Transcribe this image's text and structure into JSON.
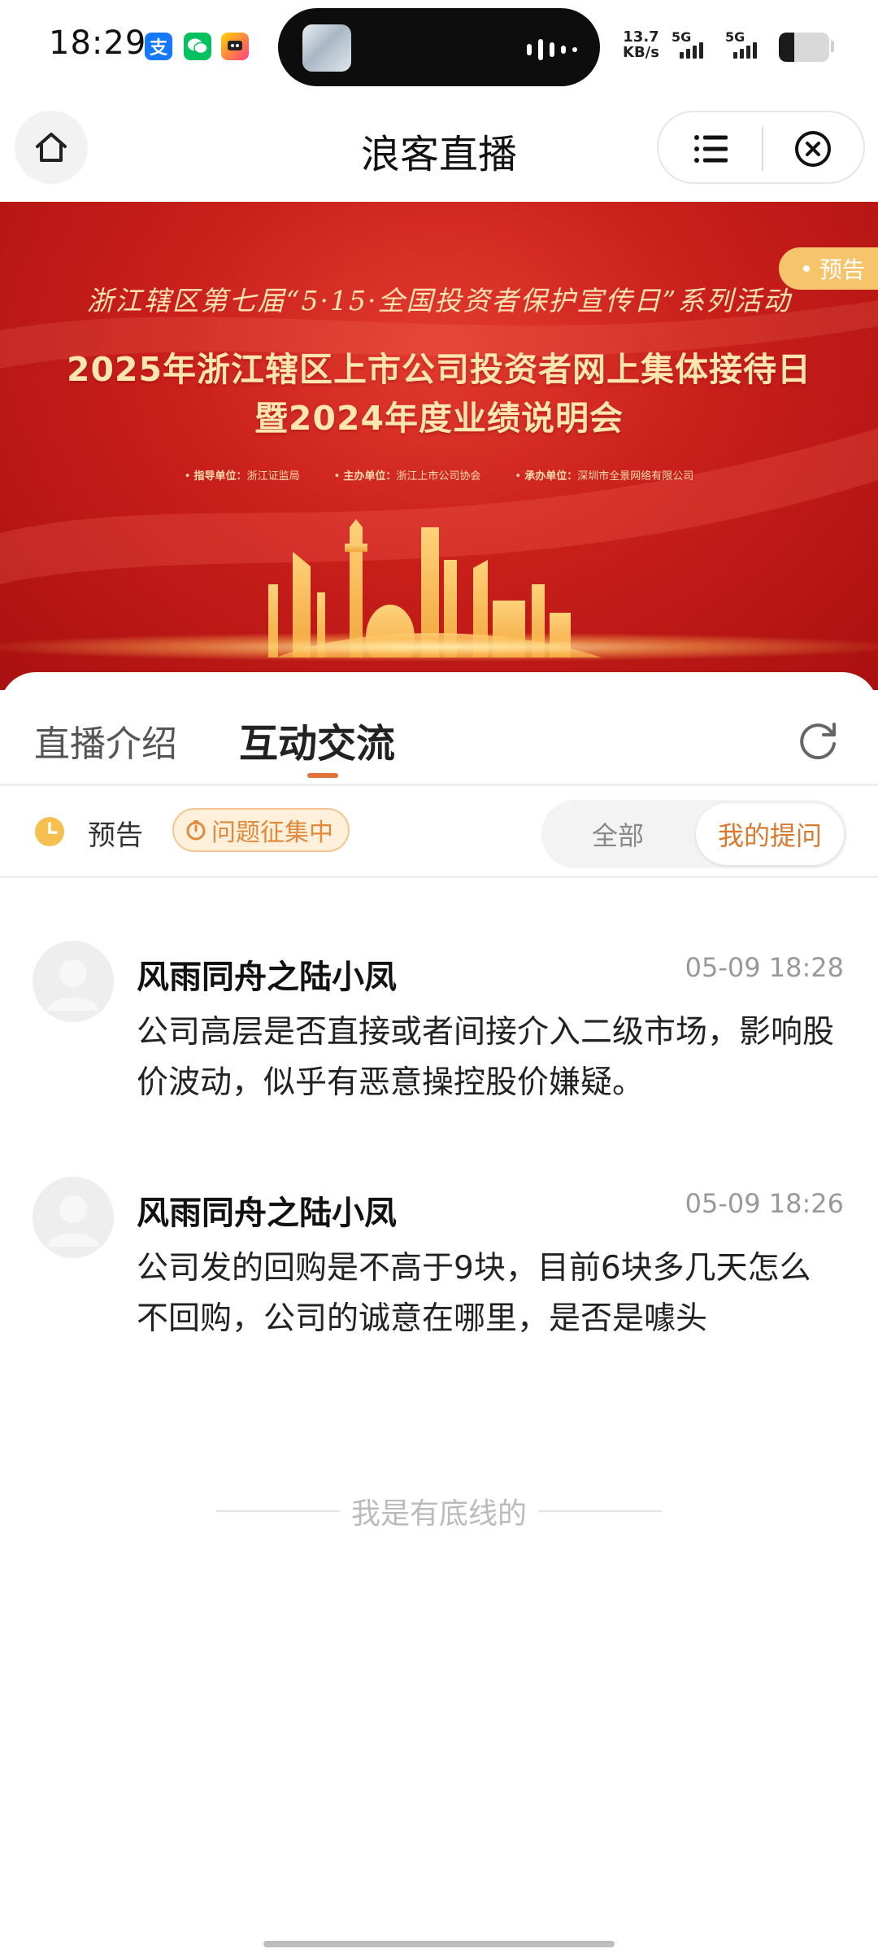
{
  "status_bar": {
    "time": "18:29",
    "net_speed_value": "13.7",
    "net_speed_unit": "KB/s",
    "sim1_label": "5G",
    "sim2_label": "5G",
    "notification_icons": [
      "alipay-icon",
      "wechat-icon",
      "game-app-icon"
    ]
  },
  "nav": {
    "title": "浪客直播",
    "home_icon": "home-icon",
    "menu_icon": "menu-list-icon",
    "close_icon": "close-circle-icon"
  },
  "banner": {
    "pre_title": "浙江辖区第七届“5·15·全国投资者保护宣传日”系列活动",
    "title_line1": "2025年浙江辖区上市公司投资者网上集体接待日",
    "title_line2": "暨2024年度业绩说明会",
    "org_guide_label": "指导单位：",
    "org_guide": "浙江证监局",
    "org_host_label": "主办单位：",
    "org_host": "浙江上市公司协会",
    "org_organizer_label": "承办单位：",
    "org_organizer": "深圳市全景网络有限公司",
    "badge": "预告",
    "colors": {
      "background": "#c91f1b",
      "text": "#ffe6b0",
      "badge": "#f6c46b"
    }
  },
  "tabs": {
    "intro": "直播介绍",
    "chat": "互动交流",
    "active": "chat"
  },
  "filter": {
    "status": "预告",
    "collect_badge": "问题征集中",
    "segment_all": "全部",
    "segment_mine": "我的提问",
    "selected": "segment_mine",
    "accent": "#d9782f"
  },
  "questions": [
    {
      "user": "风雨同舟之陆小凤",
      "time": "05-09 18:28",
      "text": "公司高层是否直接或者间接介入二级市场，影响股价波动，似乎有恶意操控股价嫌疑。"
    },
    {
      "user": "风雨同舟之陆小凤",
      "time": "05-09 18:26",
      "text": "公司发的回购是不高于9块，目前6块多几天怎么不回购，公司的诚意在哪里，是否是噱头"
    }
  ],
  "end_text": "我是有底线的"
}
